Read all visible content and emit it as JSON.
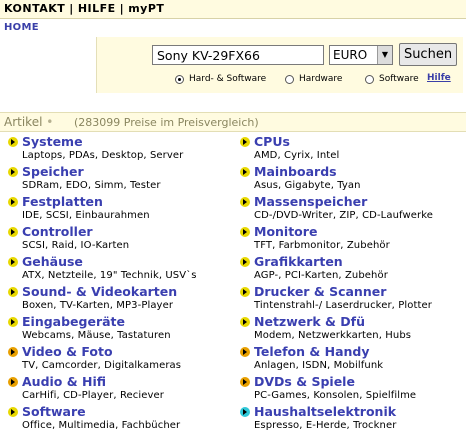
{
  "topnav": {
    "items": [
      "KONTAKT",
      "HILFE",
      "myPT"
    ],
    "separator": "|"
  },
  "breadcrumb": "HOME",
  "search": {
    "query": "Sony KV-29FX66",
    "currency": "EURO",
    "button": "Suchen",
    "options": [
      {
        "label": "Hard- & Software",
        "checked": true
      },
      {
        "label": "Hardware",
        "checked": false
      },
      {
        "label": "Software",
        "checked": false
      }
    ],
    "help_link": "Hilfe"
  },
  "artikel": {
    "title": "Artikel",
    "bullet": "•",
    "count_text": "(283099 Preise im Preisvergleich)"
  },
  "colors": {
    "bar_bg": "#fffbe0",
    "link": "#3a3fb0",
    "icon_yellow": "#e8d800",
    "icon_orange": "#e8a000",
    "icon_cyan": "#30c8d8"
  },
  "categories_left": [
    {
      "title": "Systeme",
      "sub": "Laptops, PDAs, Desktop, Server",
      "icon": "yellow"
    },
    {
      "title": "Speicher",
      "sub": "SDRam, EDO, Simm, Tester",
      "icon": "yellow"
    },
    {
      "title": "Festplatten",
      "sub": "IDE, SCSI, Einbaurahmen",
      "icon": "yellow"
    },
    {
      "title": "Controller",
      "sub": "SCSI, Raid, IO-Karten",
      "icon": "yellow"
    },
    {
      "title": "Gehäuse",
      "sub": "ATX, Netzteile, 19\" Technik, USV`s",
      "icon": "yellow"
    },
    {
      "title": "Sound- & Videokarten",
      "sub": "Boxen, TV-Karten, MP3-Player",
      "icon": "yellow"
    },
    {
      "title": "Eingabegeräte",
      "sub": "Webcams, Mäuse, Tastaturen",
      "icon": "yellow"
    },
    {
      "title": "Video & Foto",
      "sub": "TV, Camcorder, Digitalkameras",
      "icon": "orange"
    },
    {
      "title": "Audio & Hifi",
      "sub": "CarHifi, CD-Player, Reciever",
      "icon": "orange"
    },
    {
      "title": "Software",
      "sub": "Office, Multimedia, Fachbücher",
      "icon": "yellow"
    }
  ],
  "categories_right": [
    {
      "title": "CPUs",
      "sub": "AMD, Cyrix, Intel",
      "icon": "yellow"
    },
    {
      "title": "Mainboards",
      "sub": "Asus, Gigabyte, Tyan",
      "icon": "yellow"
    },
    {
      "title": "Massenspeicher",
      "sub": "CD-/DVD-Writer, ZIP, CD-Laufwerke",
      "icon": "yellow"
    },
    {
      "title": "Monitore",
      "sub": "TFT, Farbmonitor, Zubehör",
      "icon": "yellow"
    },
    {
      "title": "Grafikkarten",
      "sub": "AGP-, PCI-Karten, Zubehör",
      "icon": "yellow"
    },
    {
      "title": "Drucker & Scanner",
      "sub": "Tintenstrahl-/ Laserdrucker, Plotter",
      "icon": "yellow"
    },
    {
      "title": "Netzwerk & Dfü",
      "sub": "Modem, Netzwerkkarten, Hubs",
      "icon": "yellow"
    },
    {
      "title": "Telefon & Handy",
      "sub": "Anlagen, ISDN, Mobilfunk",
      "icon": "orange"
    },
    {
      "title": "DVDs & Spiele",
      "sub": "PC-Games, Konsolen, Spielfilme",
      "icon": "orange"
    },
    {
      "title": "Haushaltselektronik",
      "sub": "Espresso, E-Herde, Trockner",
      "icon": "cyan"
    }
  ]
}
